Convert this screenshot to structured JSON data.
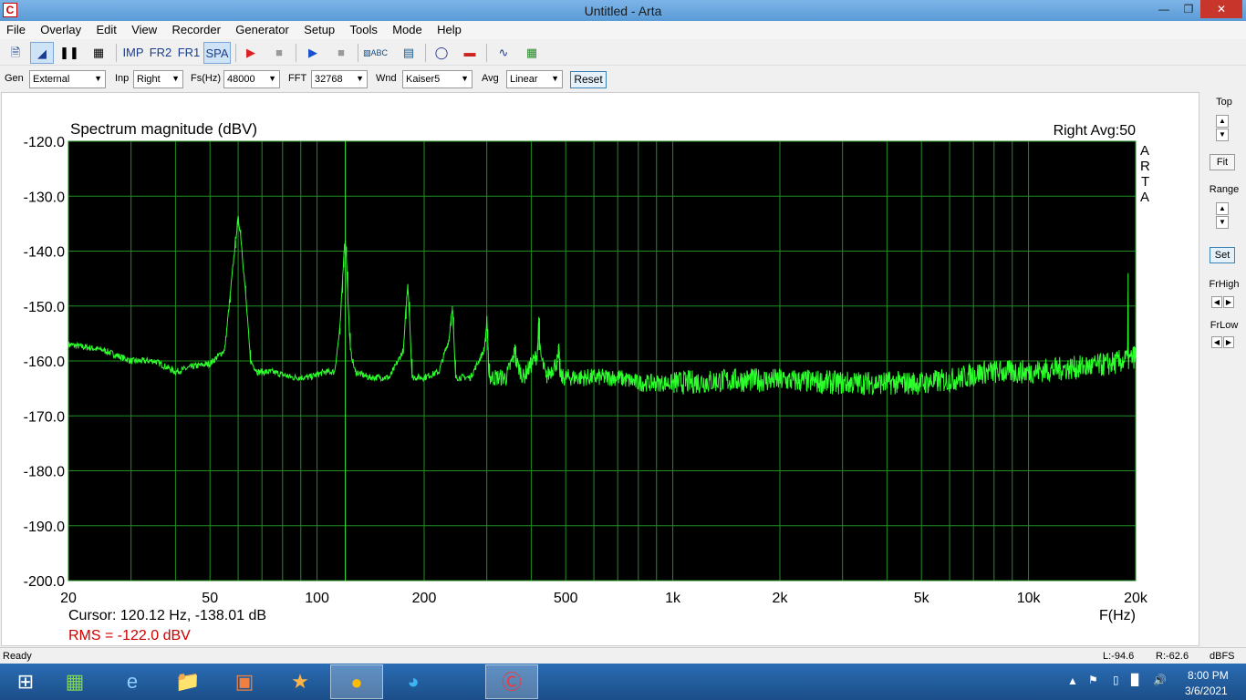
{
  "window": {
    "title": "Untitled - Arta",
    "app_icon": "C",
    "controls": [
      "minimize-icon",
      "restore-icon",
      "close-icon"
    ]
  },
  "menu": [
    "File",
    "Overlay",
    "Edit",
    "View",
    "Recorder",
    "Generator",
    "Setup",
    "Tools",
    "Mode",
    "Help"
  ],
  "toolbar": {
    "imp": "IMP",
    "fr2": "FR2",
    "fr1": "FR1",
    "spa": "SPA"
  },
  "options": {
    "gen_label": "Gen",
    "gen_value": "External",
    "inp_label": "Inp",
    "inp_value": "Right",
    "fs_label": "Fs(Hz)",
    "fs_value": "48000",
    "fft_label": "FFT",
    "fft_value": "32768",
    "wnd_label": "Wnd",
    "wnd_value": "Kaiser5",
    "avg_label": "Avg",
    "avg_value": "Linear",
    "reset": "Reset"
  },
  "right_panel": {
    "top": "Top",
    "fit": "Fit",
    "range": "Range",
    "set": "Set",
    "frhigh": "FrHigh",
    "frlow": "FrLow"
  },
  "plot": {
    "channel_info": "Right  Avg:50",
    "arta_mark": [
      "A",
      "R",
      "T",
      "A"
    ],
    "cursor_text": "Cursor: 120.12 Hz, -138.01 dB",
    "rms_text": "RMS = -122.0 dBV",
    "colors": {
      "background": "#000000",
      "grid": "#1f8f1f",
      "trace": "#2cff2c",
      "cursor": "#3cf03c",
      "rms": "#cc0000"
    }
  },
  "chart_data": {
    "type": "line",
    "title": "Spectrum magnitude (dBV)",
    "xlabel": "F(Hz)",
    "ylabel": "",
    "x_scale": "log",
    "xlim": [
      20,
      20000
    ],
    "ylim": [
      -200,
      -120
    ],
    "x_tick_labels": [
      {
        "value": 20,
        "label": "20"
      },
      {
        "value": 50,
        "label": "50"
      },
      {
        "value": 100,
        "label": "100"
      },
      {
        "value": 200,
        "label": "200"
      },
      {
        "value": 500,
        "label": "500"
      },
      {
        "value": 1000,
        "label": "1k"
      },
      {
        "value": 2000,
        "label": "2k"
      },
      {
        "value": 5000,
        "label": "5k"
      },
      {
        "value": 10000,
        "label": "10k"
      },
      {
        "value": 20000,
        "label": "20k"
      }
    ],
    "y_tick_labels": [
      "-120.0",
      "-130.0",
      "-140.0",
      "-150.0",
      "-160.0",
      "-170.0",
      "-180.0",
      "-190.0",
      "-200.0"
    ],
    "y_ticks": [
      -120,
      -130,
      -140,
      -150,
      -160,
      -170,
      -180,
      -190,
      -200
    ],
    "grid": true,
    "cursor_x": 120.12,
    "series": [
      {
        "x": [
          20,
          25,
          30,
          35,
          40,
          45,
          50,
          55,
          57,
          59,
          60,
          61,
          63,
          65,
          68,
          75,
          85,
          95,
          105,
          112,
          116,
          118,
          119,
          120,
          121,
          122,
          124,
          128,
          140,
          160,
          175,
          178,
          180,
          182,
          185,
          200,
          220,
          235,
          238,
          240,
          242,
          245,
          270,
          295,
          298,
          300,
          302,
          305,
          340,
          358,
          360,
          362,
          380,
          415,
          418,
          420,
          422,
          440,
          475,
          478,
          480,
          482,
          500,
          600,
          700,
          800,
          1000,
          1500,
          2000,
          3000,
          4000,
          5000,
          6000,
          7000,
          7500,
          8000,
          10000,
          12000,
          15000,
          17000,
          18500,
          19000,
          19050,
          19100,
          19200,
          19500,
          20000
        ],
        "y": [
          -157,
          -158,
          -160,
          -160,
          -162,
          -161,
          -160.5,
          -158,
          -148,
          -138,
          -134,
          -137,
          -148,
          -160,
          -162,
          -162,
          -163,
          -163,
          -162,
          -162,
          -154,
          -145,
          -140,
          -138,
          -141,
          -148,
          -158,
          -162,
          -163,
          -163,
          -158,
          -150,
          -146,
          -152,
          -163,
          -163,
          -162,
          -156,
          -152,
          -150,
          -155,
          -163,
          -163,
          -158,
          -155,
          -153,
          -158,
          -163,
          -163,
          -159,
          -157,
          -160,
          -163,
          -159,
          -156,
          -152,
          -158,
          -163,
          -160,
          -158,
          -160,
          -163,
          -163,
          -163,
          -163,
          -164,
          -164,
          -163.5,
          -163.5,
          -164,
          -164,
          -164,
          -163.5,
          -162.5,
          -162,
          -162,
          -162,
          -161.5,
          -161,
          -160.5,
          -160,
          -159.5,
          -144,
          -160,
          -160,
          -159.5,
          -159
        ]
      }
    ]
  },
  "status": {
    "left": "Ready",
    "l_level": "L:-94.6",
    "r_level": "R:-62.6",
    "units": "dBFS"
  },
  "taskbar": {
    "time": "8:00 PM",
    "date": "3/6/2021"
  }
}
